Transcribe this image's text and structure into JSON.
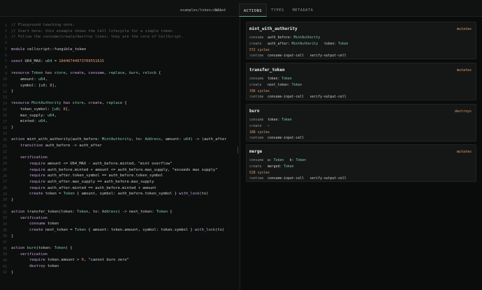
{
  "header": {
    "file_path": "examples/token.cell",
    "saved_icon": "check-icon",
    "saved_label": "Saved",
    "tabs": [
      {
        "label": "ACTIONS",
        "active": true
      },
      {
        "label": "TYPES",
        "active": false
      },
      {
        "label": "METADATA",
        "active": false
      }
    ]
  },
  "editor": {
    "lines": [
      "// Playground teaching note:",
      "// Start here: this example shows the Cell lifecycle for a simple token.",
      "// Follow the consume/create/destroy lines; they are the core of CellScript.",
      "",
      "module cellscript::fungible_token",
      "",
      "const U64_MAX: u64 = 18446744073709551615",
      "",
      "resource Token has store, create, consume, replace, burn, relock {",
      "    amount: u64,",
      "    symbol: [u8; 8],",
      "}",
      "",
      "resource MintAuthority has store, create, replace {",
      "    token_symbol: [u8; 8],",
      "    max_supply: u64,",
      "    minted: u64,",
      "}",
      "",
      "action mint_with_authority(auth_before: MintAuthority, to: Address, amount: u64) -> (auth_after",
      "    transition auth_before -> auth_after",
      "",
      "    verification",
      "        require amount <= U64_MAX - auth_before.minted, \"mint overflow\"",
      "        require auth_before.minted + amount <= auth_before.max_supply, \"exceeds max supply\"",
      "        require auth_after.token_symbol == auth_before.token_symbol",
      "        require auth_after.max_supply == auth_before.max_supply",
      "        require auth_after.minted == auth_before.minted + amount",
      "        create token = Token { amount, symbol: auth_before.token_symbol } with_lock(to)",
      "}",
      "",
      "action transfer_token(token: Token, to: Address) -> next_token: Token {",
      "    verification",
      "        consume token",
      "        create next_token = Token { amount: token.amount, symbol: token.symbol } with_lock(to)",
      "}",
      "",
      "action burn(token: Token) {",
      "    verification",
      "        require token.amount > 0, \"cannot burn zero\"",
      "        destroy token",
      "}"
    ]
  },
  "actions": [
    {
      "name": "mint_with_authority",
      "badge": "mutates",
      "rows": [
        {
          "key": "consume",
          "value": "auth_before: MintAuthority"
        },
        {
          "key": "create",
          "value": "auth_after: MintAuthority   token: Token"
        }
      ],
      "cycles": "572 cycles",
      "runtime": "consume-input-cell   verify-output-cell"
    },
    {
      "name": "transfer_token",
      "badge": "mutates",
      "rows": [
        {
          "key": "consume",
          "value": "token: Token"
        },
        {
          "key": "create",
          "value": "next_token: Token"
        }
      ],
      "cycles": "336 cycles",
      "runtime": "consume-input-cell   verify-output-cell"
    },
    {
      "name": "burn",
      "badge": "destroys",
      "rows": [
        {
          "key": "consume",
          "value": "token: Token"
        },
        {
          "key": "create",
          "value": "—"
        }
      ],
      "cycles": "188 cycles",
      "runtime": "consume-input-cell"
    },
    {
      "name": "merge",
      "badge": "mutates",
      "rows": [
        {
          "key": "consume",
          "value": "a: Token   b: Token"
        },
        {
          "key": "create",
          "value": "merged: Token"
        }
      ],
      "cycles": "528 cycles",
      "runtime": "consume-input-cell   verify-output-cell"
    }
  ],
  "runtime_label": "runtime"
}
